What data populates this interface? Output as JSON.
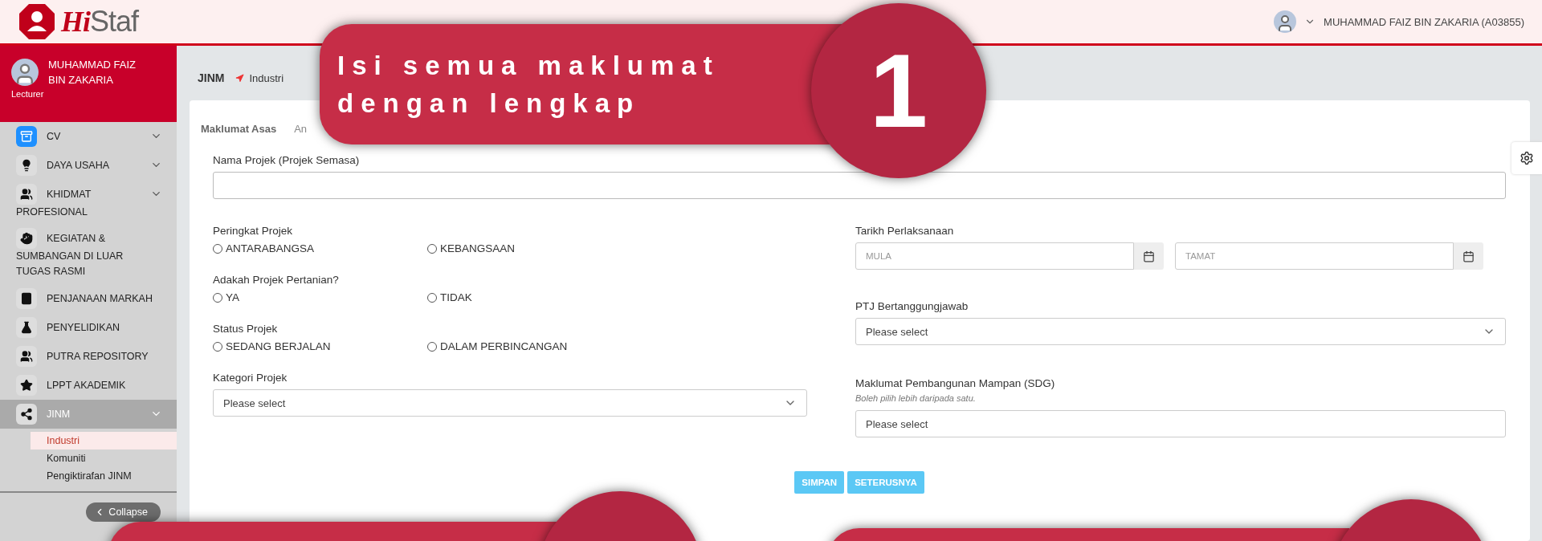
{
  "header": {
    "logo": {
      "script": "Hi",
      "plain": "Staf"
    },
    "user": "MUHAMMAD FAIZ BIN ZAKARIA (A03855)"
  },
  "sidebar": {
    "profile": {
      "name": "MUHAMMAD FAIZ BIN ZAKARIA",
      "role": "Lecturer"
    },
    "items": [
      {
        "label": "CV",
        "expandable": true,
        "selected": false
      },
      {
        "label": "DAYA USAHA",
        "expandable": true,
        "selected": false
      },
      {
        "label": "KHIDMAT PROFESIONAL",
        "expandable": true,
        "selected": false
      },
      {
        "label": "KEGIATAN & SUMBANGAN DI LUAR TUGAS RASMI",
        "expandable": false,
        "selected": false
      },
      {
        "label": "PENJANAAN MARKAH",
        "expandable": false,
        "selected": false
      },
      {
        "label": "PENYELIDIKAN",
        "expandable": false,
        "selected": false
      },
      {
        "label": "PUTRA REPOSITORY",
        "expandable": false,
        "selected": false
      },
      {
        "label": "LPPT AKADEMIK",
        "expandable": false,
        "selected": false
      },
      {
        "label": "JINM",
        "expandable": true,
        "selected": true,
        "children": [
          {
            "label": "Industri",
            "selected": true
          },
          {
            "label": "Komuniti",
            "selected": false
          },
          {
            "label": "Pengiktirafan JINM",
            "selected": false
          }
        ]
      }
    ],
    "collapse": "Collapse"
  },
  "breadcrumb": {
    "section": "JINM",
    "page": "Industri"
  },
  "tabs": [
    {
      "label": "Maklumat Asas",
      "selected": true
    },
    {
      "label": "An",
      "selected": false
    }
  ],
  "project_name": {
    "label": "Nama Projek (Projek Semasa)"
  },
  "left_fields": [
    {
      "kind": "radio",
      "label": "Peringkat Projek",
      "options": [
        {
          "label": "ANTARABANGSA",
          "selected": false
        },
        {
          "label": "KEBANGSAAN",
          "selected": false
        }
      ]
    },
    {
      "kind": "radio",
      "label": "Adakah Projek Pertanian?",
      "options": [
        {
          "label": "YA",
          "selected": false
        },
        {
          "label": "TIDAK",
          "selected": false
        }
      ]
    },
    {
      "kind": "radio",
      "label": "Status Projek",
      "options": [
        {
          "label": "SEDANG BERJALAN",
          "selected": false
        },
        {
          "label": "DALAM PERBINCANGAN",
          "selected": false
        }
      ]
    },
    {
      "kind": "select",
      "label": "Kategori Projek",
      "placeholder": "Please select"
    }
  ],
  "right_fields": [
    {
      "kind": "dates",
      "label": "Tarikh Perlaksanaan",
      "start_placeholder": "MULA",
      "end_placeholder": "TAMAT"
    },
    {
      "kind": "select",
      "label": "PTJ Bertanggungjawab",
      "placeholder": "Please select"
    },
    {
      "kind": "multi",
      "label": "Maklumat Pembangunan Mampan (SDG)",
      "hint": "Boleh pilih lebih daripada satu.",
      "placeholder": "Please select"
    }
  ],
  "buttons": [
    "SIMPAN",
    "SETERUSNYA"
  ],
  "callout": {
    "text": "Isi semua maklumat dengan lengkap",
    "number": "1"
  }
}
